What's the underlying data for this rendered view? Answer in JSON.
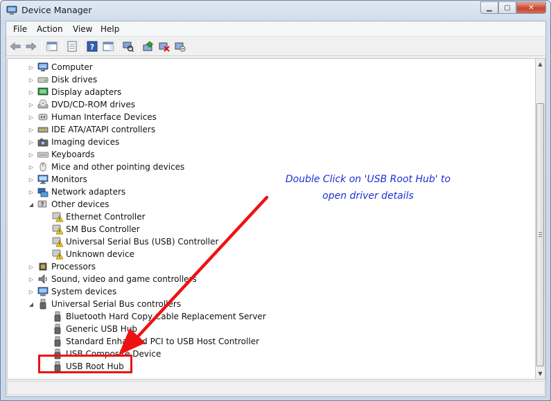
{
  "window": {
    "title": "Device Manager"
  },
  "menu": [
    "File",
    "Action",
    "View",
    "Help"
  ],
  "tree": [
    {
      "label": "Computer",
      "icon": "computer-icon"
    },
    {
      "label": "Disk drives",
      "icon": "disk-drive-icon"
    },
    {
      "label": "Display adapters",
      "icon": "display-adapter-icon"
    },
    {
      "label": "DVD/CD-ROM drives",
      "icon": "dvd-drive-icon"
    },
    {
      "label": "Human Interface Devices",
      "icon": "hid-icon"
    },
    {
      "label": "IDE ATA/ATAPI controllers",
      "icon": "ide-controller-icon"
    },
    {
      "label": "Imaging devices",
      "icon": "camera-icon"
    },
    {
      "label": "Keyboards",
      "icon": "keyboard-icon"
    },
    {
      "label": "Mice and other pointing devices",
      "icon": "mouse-icon"
    },
    {
      "label": "Monitors",
      "icon": "monitor-icon"
    },
    {
      "label": "Network adapters",
      "icon": "network-adapter-icon"
    },
    {
      "label": "Other devices",
      "icon": "unknown-device-icon",
      "expanded": true,
      "children": [
        "Ethernet Controller",
        "SM Bus Controller",
        "Universal Serial Bus (USB) Controller",
        "Unknown device"
      ]
    },
    {
      "label": "Processors",
      "icon": "processor-icon"
    },
    {
      "label": "Sound, video and game controllers",
      "icon": "speaker-icon"
    },
    {
      "label": "System devices",
      "icon": "system-device-icon"
    },
    {
      "label": "Universal Serial Bus controllers",
      "icon": "usb-icon",
      "expanded": true,
      "children": [
        "Bluetooth Hard Copy Cable Replacement Server",
        "Generic USB Hub",
        "Standard Enhanced PCI to USB Host Controller",
        "USB Composite Device",
        "USB Root Hub"
      ]
    }
  ],
  "annotation": {
    "line1": "Double Click on 'USB Root Hub' to",
    "line2": "open driver details",
    "color": "#1a2fd6",
    "arrow_color": "#ee1111"
  }
}
